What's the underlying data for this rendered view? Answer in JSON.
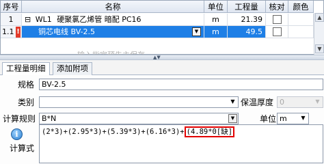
{
  "grid": {
    "headers": {
      "index": "序号",
      "name": "名称",
      "unit": "单位",
      "quantity": "工程量",
      "check": "核对",
      "color": "颜色"
    },
    "rows": [
      {
        "index": "1",
        "expander": "⊟",
        "code": "WL1",
        "name": "硬聚氯乙烯管 暗配 PC16",
        "unit": "m",
        "quantity": "21.39",
        "checked": false
      },
      {
        "index": "1.1",
        "flag": "!",
        "name": "铜芯电线 BV-2.5",
        "unit": "m",
        "quantity": "49.5",
        "checked": false,
        "selected": true
      }
    ],
    "faded_hint": "输入指定预先主保存",
    "scroll_up": "▲",
    "scroll_down": "▼"
  },
  "tabs": [
    {
      "label": "工程量明细",
      "active": true
    },
    {
      "label": "添加附项",
      "active": false
    }
  ],
  "form": {
    "spec_label": "规格",
    "spec_value": "BV-2.5",
    "category_label": "类别",
    "category_value": "",
    "insulation_label": "保温厚度",
    "insulation_value": "0",
    "rule_label": "计算规则",
    "rule_value": "B*N",
    "unit_label": "单位",
    "unit_value": "m",
    "formula_label": "计算式",
    "formula_text": "(2*3)+(2.95*3)+(5.39*3)+(6.16*3)+",
    "formula_missing": "(4.89*0[缺]",
    "info_icon_glyph": "i"
  },
  "colors": {
    "selection": "#1e7fe6",
    "missing_border": "#e20000",
    "flag_bg": "#e23b2a"
  }
}
